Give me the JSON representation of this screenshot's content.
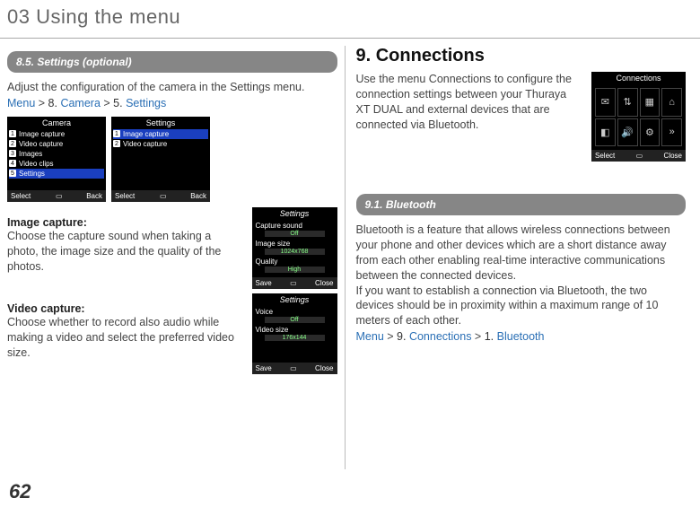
{
  "chapter": "03 Using the menu",
  "pageNumber": "62",
  "left": {
    "sectionBar": "8.5. Settings (optional)",
    "intro": "Adjust the configuration of the camera in the Settings menu.",
    "breadcrumb": {
      "menu": "Menu",
      "step1num": "8.",
      "step1": "Camera",
      "step2num": "5.",
      "step2": "Settings",
      "gt": " > "
    },
    "cameraScreen": {
      "title": "Camera",
      "items": [
        "Image capture",
        "Video capture",
        "Images",
        "Video clips",
        "Settings"
      ],
      "selIndex": 4,
      "softLeft": "Select",
      "softRight": "Back"
    },
    "settingsListScreen": {
      "title": "Settings",
      "items": [
        "Image capture",
        "Video capture"
      ],
      "selIndex": 0,
      "softLeft": "Select",
      "softRight": "Back"
    },
    "imageCapture": {
      "heading": "Image capture:",
      "body": "Choose the capture sound when taking a photo, the image size and the quality of the photos.",
      "screen": {
        "title": "Settings",
        "rows": [
          {
            "label": "Capture sound",
            "value": "Off"
          },
          {
            "label": "Image size",
            "value": "1024x768"
          },
          {
            "label": "Quality",
            "value": "High"
          }
        ],
        "softLeft": "Save",
        "softRight": "Close"
      }
    },
    "videoCapture": {
      "heading": "Video capture:",
      "body": "Choose whether to record also audio while making a video  and select the preferred video size.",
      "screen": {
        "title": "Settings",
        "rows": [
          {
            "label": "Voice",
            "value": "Off"
          },
          {
            "label": "Video size",
            "value": "176x144"
          }
        ],
        "softLeft": "Save",
        "softRight": "Close"
      }
    }
  },
  "right": {
    "heading": "9. Connections",
    "intro": "Use the menu Connections to configure the connection settings between your Thuraya XT DUAL and external devices that are connected via Bluetooth.",
    "connScreen": {
      "title": "Connections",
      "softLeft": "Select",
      "softRight": "Close",
      "icons": [
        "✉",
        "⇅",
        "▦",
        "⌂",
        "◧",
        "🔊",
        "⚙",
        "»"
      ]
    },
    "sectionBar": "9.1. Bluetooth",
    "bt": {
      "p1": "Bluetooth is a feature that allows wireless connections between your phone and other devices which are a short distance away from each other enabling real-time interactive communications between the connected devices.",
      "p2": "If you want to establish a connection via Bluetooth, the two devices should be in proximity within a maximum range of 10 meters of each other."
    },
    "breadcrumb": {
      "menu": "Menu",
      "step1num": "9.",
      "step1": "Connections",
      "step2num": "1.",
      "step2": "Bluetooth",
      "gt": " > "
    }
  }
}
